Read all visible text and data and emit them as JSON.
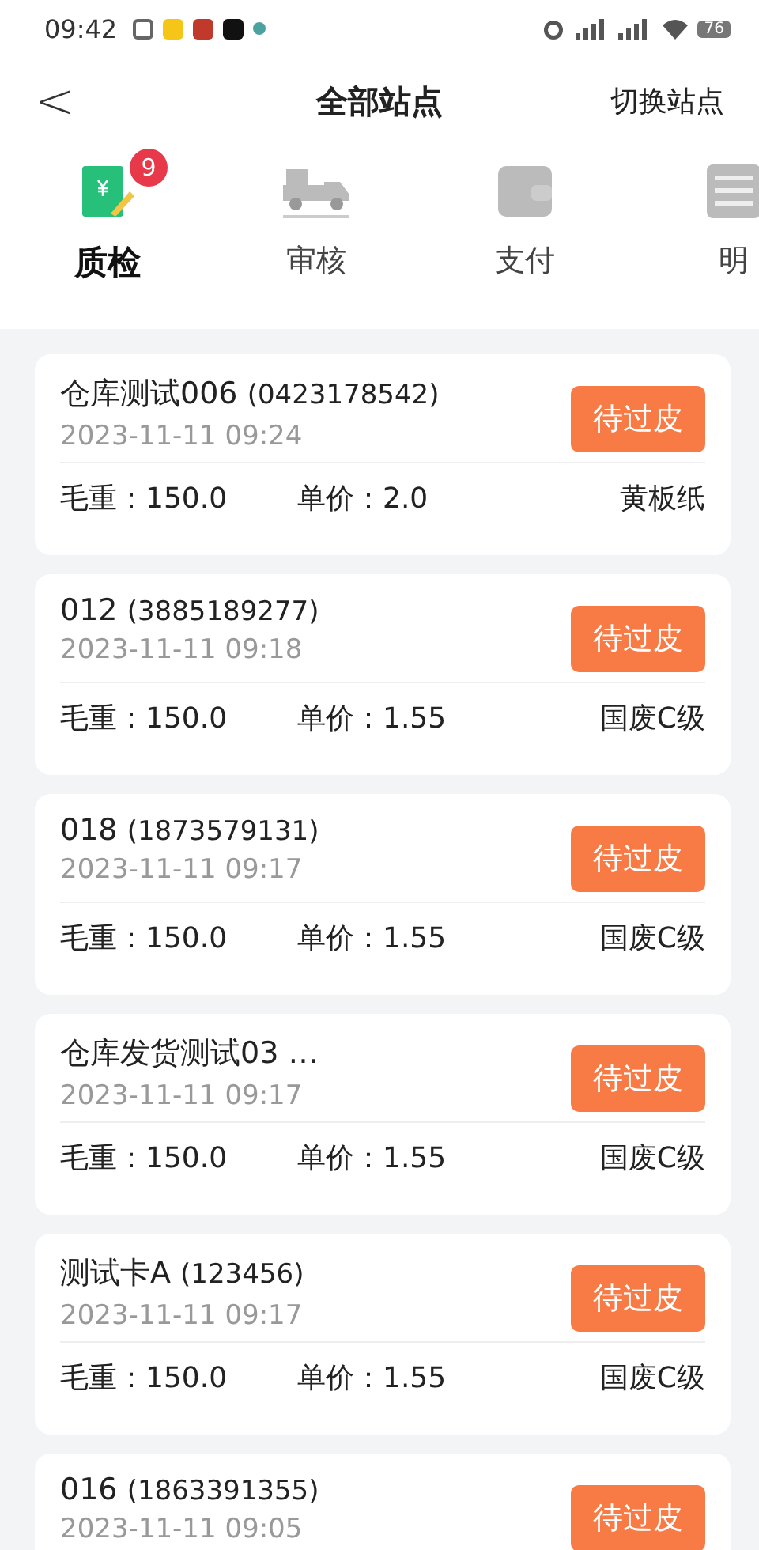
{
  "status_bar": {
    "time": "09:42",
    "battery": "76"
  },
  "header": {
    "back": "<",
    "title": "全部站点",
    "action": "切换站点"
  },
  "tabs": [
    {
      "label": "质检",
      "selected": true,
      "badge": "9",
      "kind": "invoice"
    },
    {
      "label": "审核",
      "selected": false,
      "kind": "truck"
    },
    {
      "label": "支付",
      "selected": false,
      "kind": "wallet"
    },
    {
      "label": "明",
      "selected": false,
      "kind": "list"
    }
  ],
  "orders": [
    {
      "name": "仓库测试006",
      "code": "(0423178542)",
      "time": "2023-11-11 09:24",
      "gross": "毛重：150.0",
      "price": "单价：2.0",
      "category": "黄板纸",
      "status": "待过皮"
    },
    {
      "name": "012",
      "code": "(3885189277)",
      "time": "2023-11-11 09:18",
      "gross": "毛重：150.0",
      "price": "单价：1.55",
      "category": "国废C级",
      "status": "待过皮"
    },
    {
      "name": "018",
      "code": "(1873579131)",
      "time": "2023-11-11 09:17",
      "gross": "毛重：150.0",
      "price": "单价：1.55",
      "category": "国废C级",
      "status": "待过皮"
    },
    {
      "name": "仓库发货测试03 …",
      "time": "2023-11-11 09:17",
      "gross": "毛重：150.0",
      "price": "单价：1.55",
      "category": "国废C级",
      "status": "待过皮"
    },
    {
      "name": "测试卡A",
      "code": "(123456)",
      "time": "2023-11-11 09:17",
      "gross": "毛重：150.0",
      "price": "单价：1.55",
      "category": "国废C级",
      "status": "待过皮"
    },
    {
      "name": "016",
      "code": "(1863391355)",
      "time": "2023-11-11 09:05",
      "status": "待过皮"
    }
  ]
}
